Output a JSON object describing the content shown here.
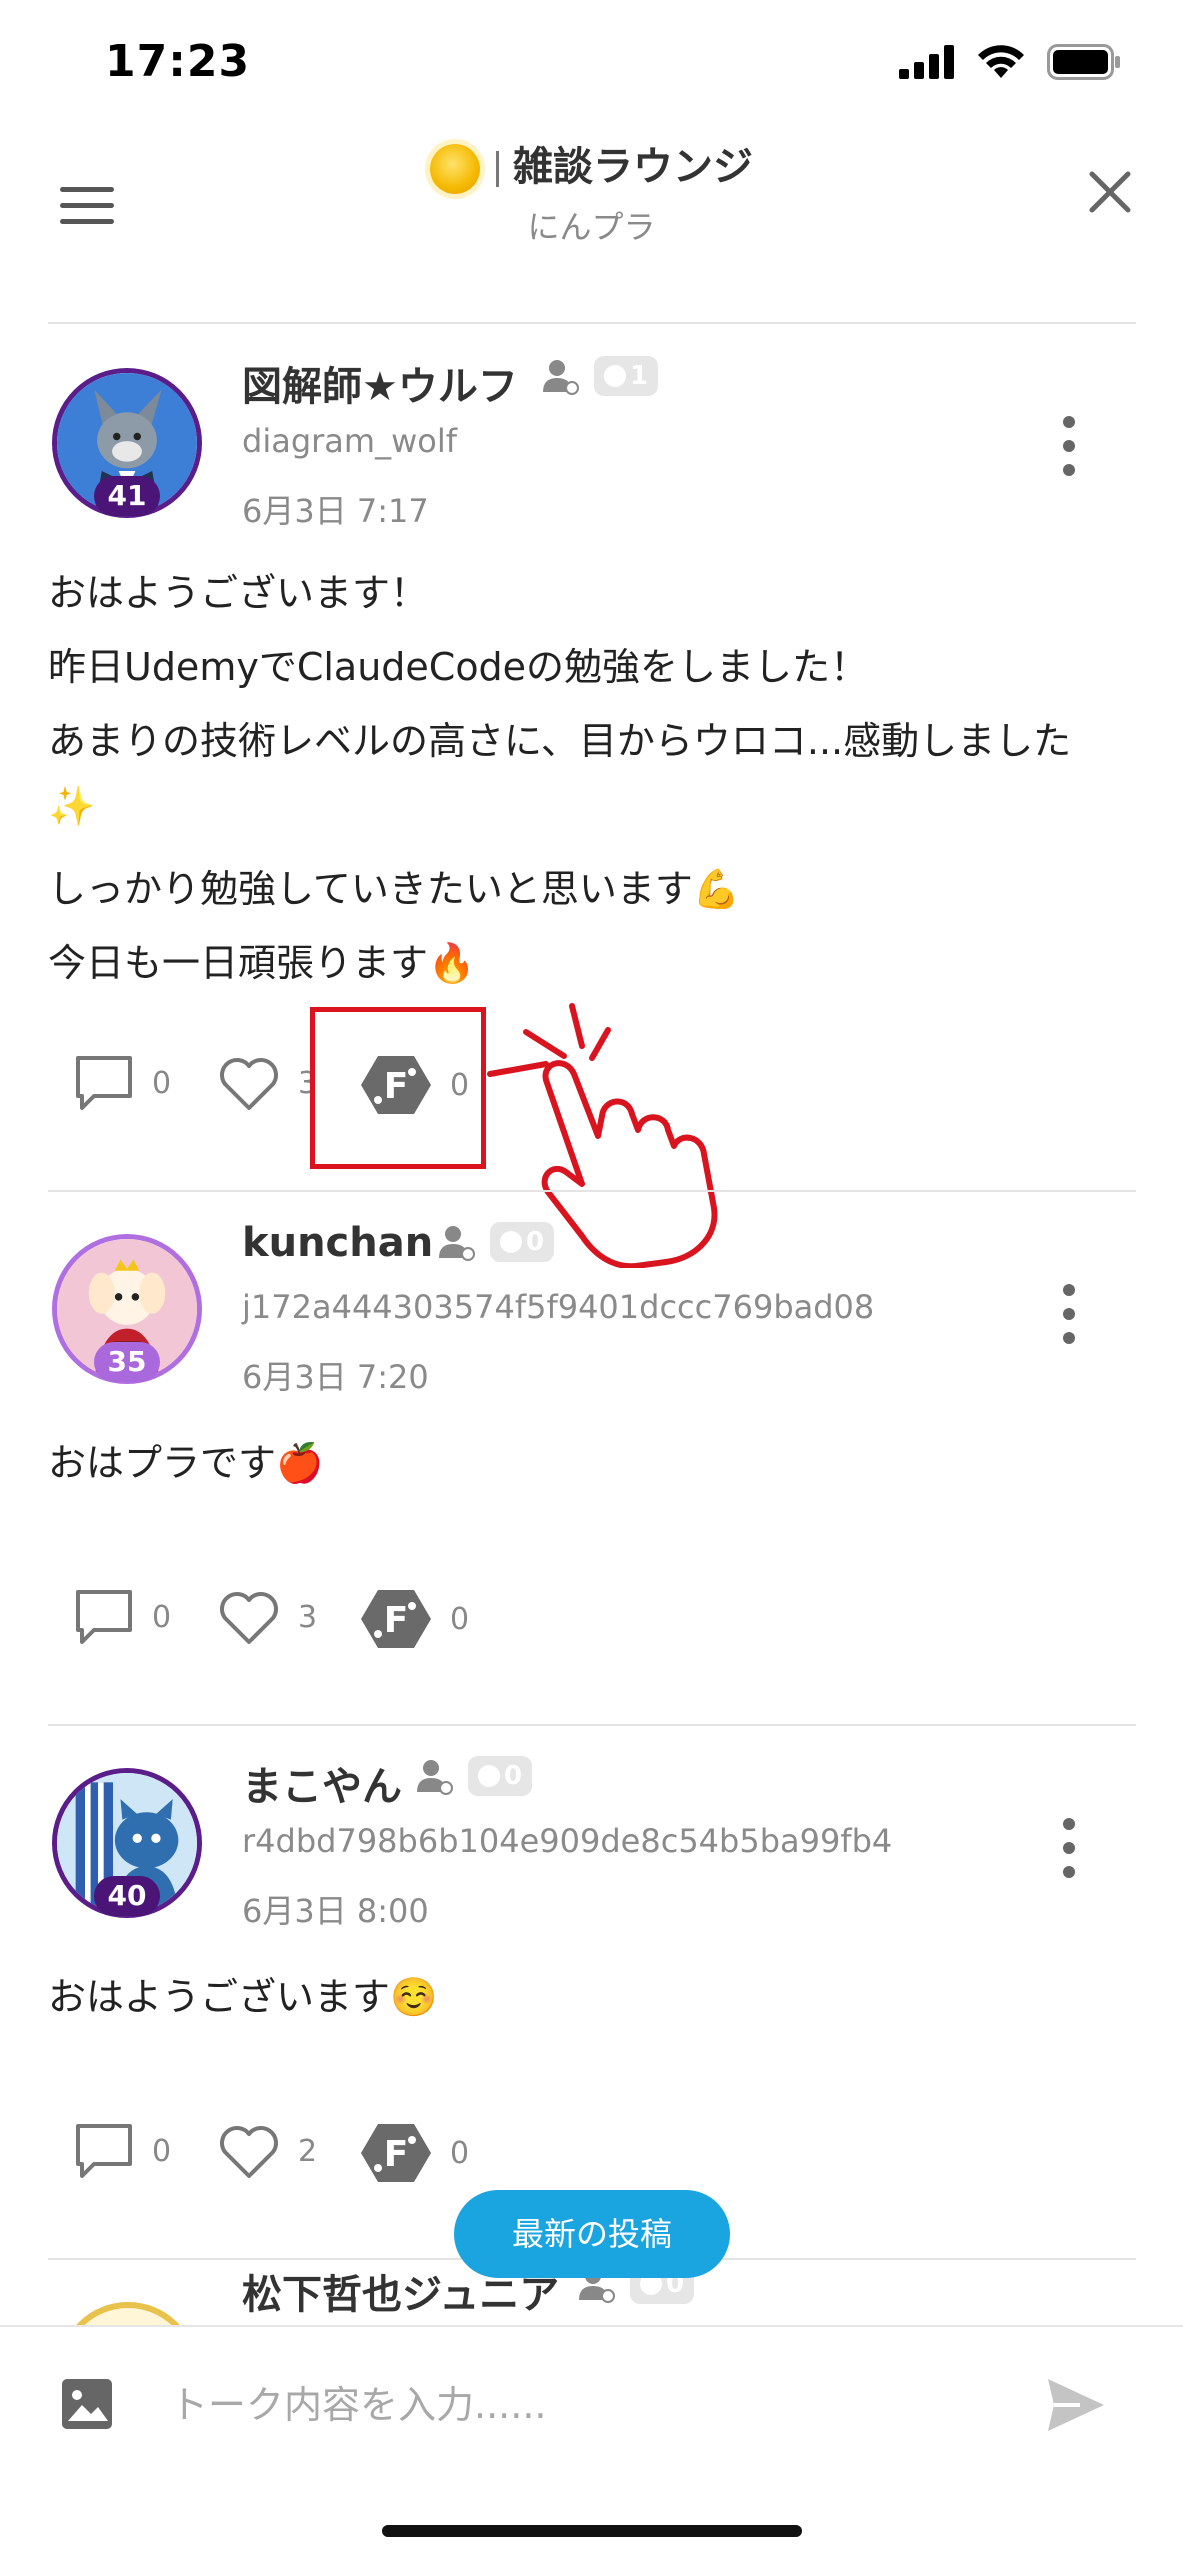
{
  "status_bar": {
    "time": "17:23"
  },
  "header": {
    "title": "雑談ラウンジ",
    "subtitle": "にんプラ"
  },
  "posts": [
    {
      "user_name": "図解師★ウルフ",
      "badge_count": "1",
      "user_id": "diagram_wolf",
      "date": "6月3日 7:17",
      "level": "41",
      "body": [
        "おはようございます！",
        "昨日UdemyでClaudeCodeの勉強をしました！",
        "あまりの技術レベルの高さに、目からウロコ...感動しました",
        "✨",
        "しっかり勉強していきたいと思います💪",
        "今日も一日頑張ります🔥"
      ],
      "comments": "0",
      "likes": "3",
      "f_points": "0"
    },
    {
      "user_name": "kunchan",
      "badge_count": "0",
      "user_id": "j172a444303574f5f9401dccc769bad08",
      "date": "6月3日 7:20",
      "level": "35",
      "body": [
        "おはプラです🍎"
      ],
      "comments": "0",
      "likes": "3",
      "f_points": "0"
    },
    {
      "user_name": "まこやん",
      "badge_count": "0",
      "user_id": "r4dbd798b6b104e909de8c54b5ba99fb4",
      "date": "6月3日 8:00",
      "level": "40",
      "body": [
        "おはようございます☺️"
      ],
      "comments": "0",
      "likes": "2",
      "f_points": "0"
    },
    {
      "user_name": "松下哲也ジュニア",
      "badge_count": "0"
    }
  ],
  "latest_button": "最新の投稿",
  "composer": {
    "placeholder": "トーク内容を入力......"
  },
  "colors": {
    "accent": "#1aa5e0",
    "highlight": "#d9141e",
    "level_badge": "#4a1577"
  }
}
